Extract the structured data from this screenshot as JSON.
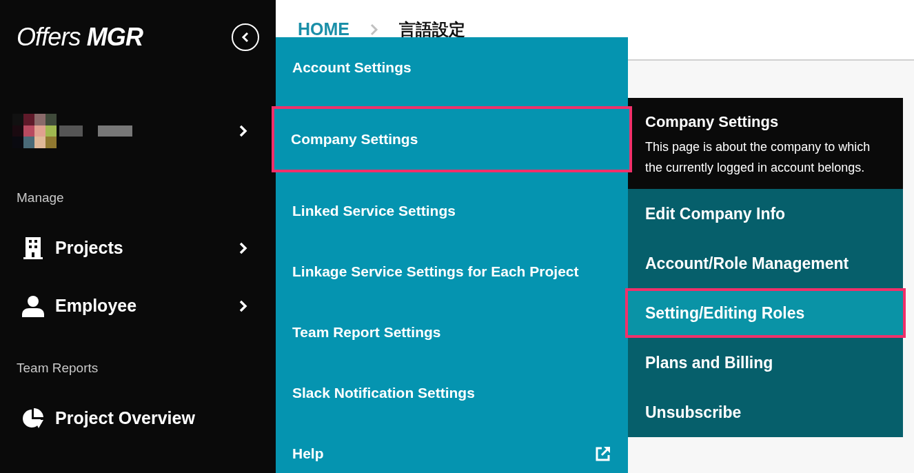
{
  "sidebar": {
    "logo": "Offers **MGR**",
    "sections": [
      {
        "heading": "Manage",
        "items": [
          {
            "label": "Projects",
            "has_submenu": true
          },
          {
            "label": "Employee",
            "has_submenu": true
          }
        ]
      },
      {
        "heading": "Team Reports",
        "items": [
          {
            "label": "Project Overview",
            "has_submenu": false
          }
        ]
      }
    ]
  },
  "breadcrumb": [
    "HOME",
    "言語設定"
  ],
  "menu": {
    "items": [
      {
        "label": "Account Settings",
        "selected": false,
        "external": false
      },
      {
        "label": "Company Settings",
        "selected": true,
        "external": false
      },
      {
        "label": "Linked Service Settings",
        "selected": false,
        "external": false
      },
      {
        "label": "Linkage Service Settings for Each Project",
        "selected": false,
        "external": false
      },
      {
        "label": "Team Report Settings",
        "selected": false,
        "external": false
      },
      {
        "label": "Slack Notification Settings",
        "selected": false,
        "external": false
      },
      {
        "label": "Help",
        "selected": false,
        "external": true
      }
    ]
  },
  "submenu": {
    "title": "Company Settings",
    "description": "This page is about the company to which the currently logged in account belongs.",
    "items": [
      {
        "label": "Edit Company Info",
        "selected": false
      },
      {
        "label": "Account/Role Management",
        "selected": false
      },
      {
        "label": "Setting/Editing Roles",
        "selected": true
      },
      {
        "label": "Plans and Billing",
        "selected": false
      },
      {
        "label": "Unsubscribe",
        "selected": false
      }
    ]
  }
}
